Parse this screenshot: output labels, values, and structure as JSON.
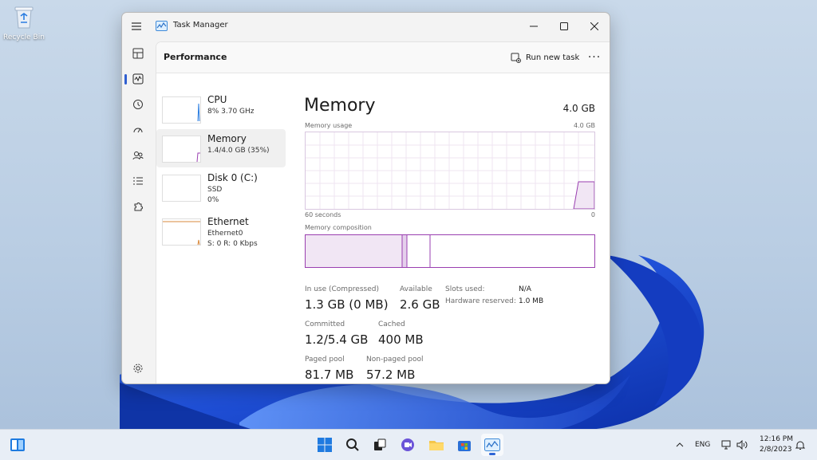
{
  "desktop": {
    "recycle_bin_label": "Recycle Bin"
  },
  "window": {
    "title": "Task Manager",
    "page_title": "Performance",
    "run_new_task_label": "Run new task",
    "more_label": "···"
  },
  "devices": [
    {
      "name": "CPU",
      "line2": "8%  3.70 GHz",
      "line3": ""
    },
    {
      "name": "Memory",
      "line2": "1.4/4.0 GB (35%)",
      "line3": ""
    },
    {
      "name": "Disk 0 (C:)",
      "line2": "SSD",
      "line3": "0%"
    },
    {
      "name": "Ethernet",
      "line2": "Ethernet0",
      "line3": "S: 0  R: 0 Kbps"
    }
  ],
  "memory": {
    "title": "Memory",
    "total": "4.0 GB",
    "usage_label": "Memory usage",
    "usage_max": "4.0 GB",
    "time_left": "60 seconds",
    "time_right": "0",
    "composition_label": "Memory composition",
    "stats": {
      "in_use_label": "In use (Compressed)",
      "in_use_value": "1.3 GB (0 MB)",
      "available_label": "Available",
      "available_value": "2.6 GB",
      "committed_label": "Committed",
      "committed_value": "1.2/5.4 GB",
      "cached_label": "Cached",
      "cached_value": "400 MB",
      "paged_label": "Paged pool",
      "paged_value": "81.7 MB",
      "nonpaged_label": "Non-paged pool",
      "nonpaged_value": "57.2 MB",
      "slots_label": "Slots used:",
      "slots_value": "N/A",
      "hw_label": "Hardware reserved:",
      "hw_value": "1.0 MB"
    }
  },
  "tray": {
    "language": "ENG",
    "time": "12:16 PM",
    "date": "2/8/2023"
  },
  "colors": {
    "memory_accent": "#9a3fb0",
    "memory_fill": "#f1e6f4",
    "accent": "#2f5fd0"
  }
}
